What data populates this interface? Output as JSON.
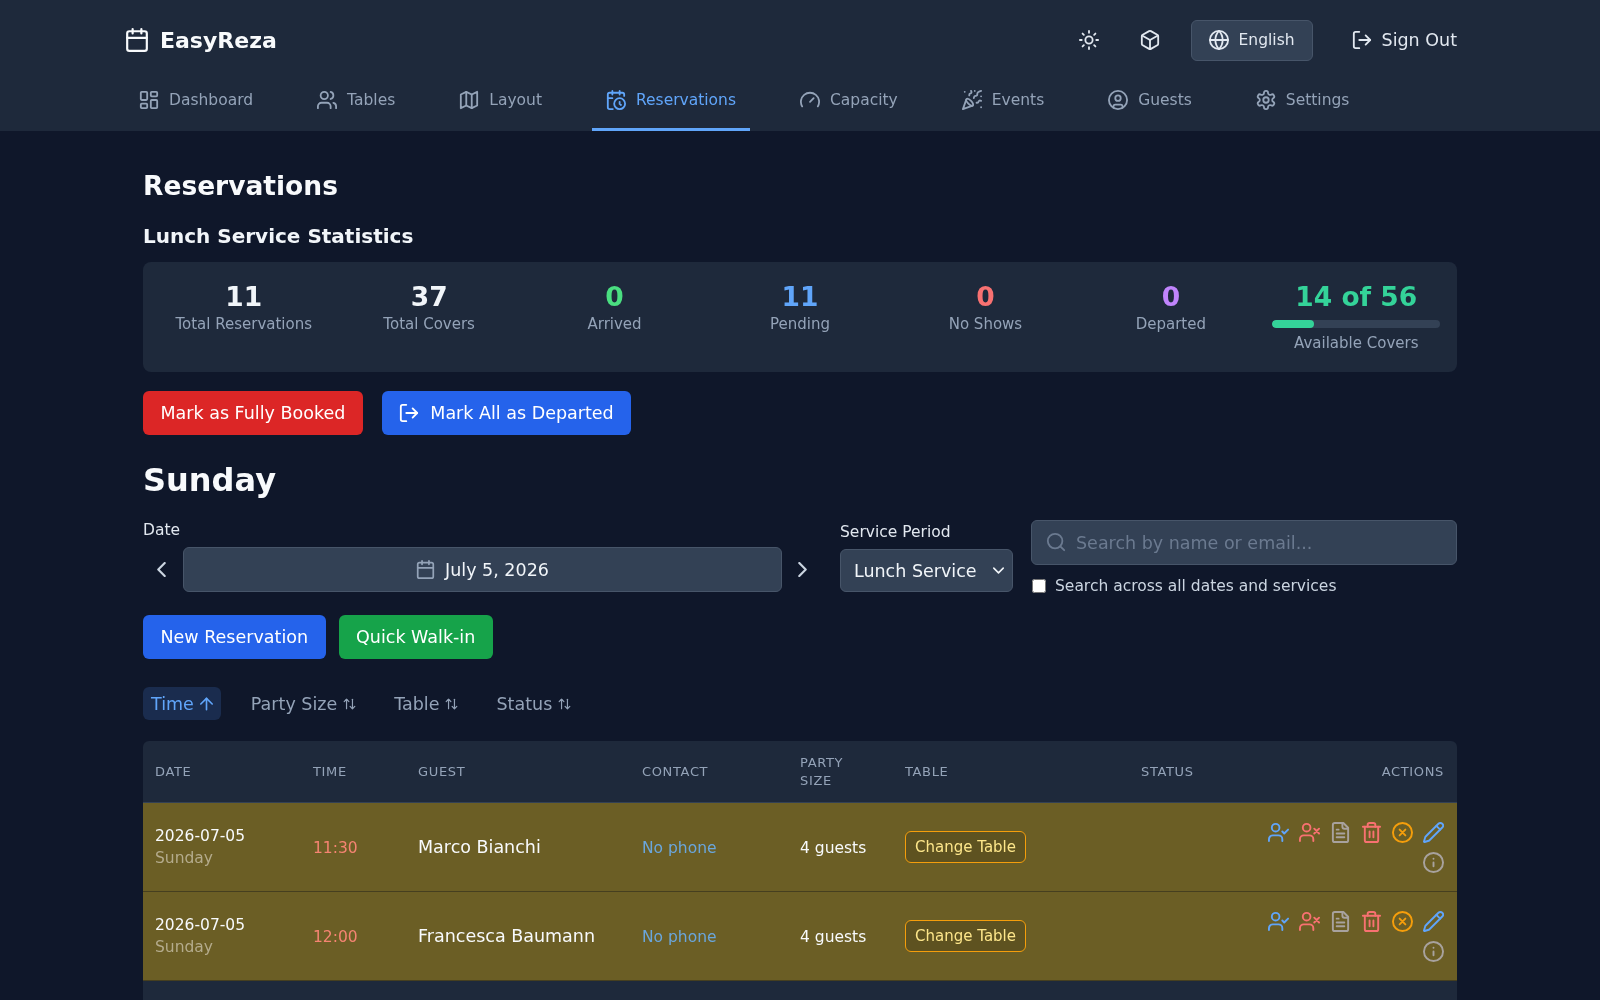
{
  "header": {
    "brand": "EasyReza",
    "language": "English",
    "sign_out": "Sign Out"
  },
  "nav": [
    {
      "label": "Dashboard",
      "selected": false
    },
    {
      "label": "Tables",
      "selected": false
    },
    {
      "label": "Layout",
      "selected": false
    },
    {
      "label": "Reservations",
      "selected": true
    },
    {
      "label": "Capacity",
      "selected": false
    },
    {
      "label": "Events",
      "selected": false
    },
    {
      "label": "Guests",
      "selected": false
    },
    {
      "label": "Settings",
      "selected": false
    }
  ],
  "page_title": "Reservations",
  "stats": {
    "title": "Lunch Service Statistics",
    "items": [
      {
        "kind": "count",
        "value": "11",
        "label": "Total Reservations",
        "color": "#f1f5f9"
      },
      {
        "kind": "count",
        "value": "37",
        "label": "Total Covers",
        "color": "#f1f5f9"
      },
      {
        "kind": "count",
        "value": "0",
        "label": "Arrived",
        "color": "#4ade80"
      },
      {
        "kind": "count",
        "value": "11",
        "label": "Pending",
        "color": "#60a5fa"
      },
      {
        "kind": "count",
        "value": "0",
        "label": "No Shows",
        "color": "#f87171"
      },
      {
        "kind": "count",
        "value": "0",
        "label": "Departed",
        "color": "#c084fc"
      },
      {
        "kind": "meter",
        "value": "14 of 56",
        "label": "Available Covers",
        "color": "#34d399",
        "level": 0.25
      }
    ]
  },
  "bulk_actions": [
    {
      "label": "Mark as Fully Booked",
      "kind": "danger"
    },
    {
      "label": "Mark All as Departed",
      "kind": "primary"
    }
  ],
  "day_heading": "Sunday",
  "filters": {
    "date_label": "Date",
    "date_value": "July 5, 2026",
    "service_label": "Service Period",
    "service_value": "Lunch Service",
    "search_placeholder": "Search by name or email...",
    "search_all": {
      "label": "Search across all dates and services",
      "checked": false
    }
  },
  "create_actions": [
    {
      "label": "New Reservation",
      "kind": "primary"
    },
    {
      "label": "Quick Walk-in",
      "kind": "success"
    }
  ],
  "sort_options": [
    {
      "label": "Time",
      "selected": true
    },
    {
      "label": "Party Size",
      "selected": false
    },
    {
      "label": "Table",
      "selected": false
    },
    {
      "label": "Status",
      "selected": false
    }
  ],
  "table": {
    "columns": [
      "DATE",
      "TIME",
      "GUEST",
      "CONTACT",
      "PARTY SIZE",
      "TABLE",
      "STATUS",
      "ACTIONS"
    ],
    "rows": [
      {
        "date": "2026-07-05",
        "day": "Sunday",
        "time": "11:30",
        "guest": "Marco Bianchi",
        "contact": "No phone",
        "party_size": "4 guests",
        "table_action": "Change Table",
        "highlighted": true
      },
      {
        "date": "2026-07-05",
        "day": "Sunday",
        "time": "12:00",
        "guest": "Francesca Baumann",
        "contact": "No phone",
        "party_size": "4 guests",
        "table_action": "Change Table",
        "highlighted": true
      }
    ]
  }
}
